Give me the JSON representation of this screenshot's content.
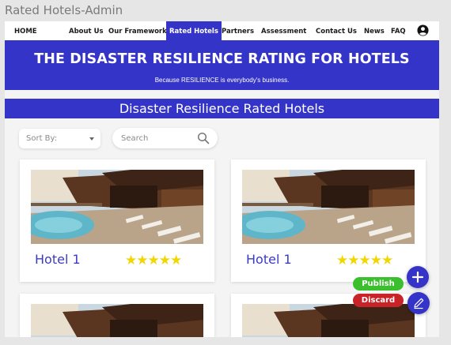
{
  "frame": {
    "title": "Rated Hotels-Admin"
  },
  "nav": {
    "home": "HOME",
    "items": [
      {
        "label": "About Us"
      },
      {
        "label": "Our Framework"
      },
      {
        "label": "Rated Hotels",
        "active": true
      },
      {
        "label": "Partners"
      },
      {
        "label": "Assessment"
      },
      {
        "label": "Contact Us"
      },
      {
        "label": "News"
      },
      {
        "label": "FAQ"
      }
    ],
    "user_icon": "account-circle-icon"
  },
  "hero": {
    "title": "THE DISASTER RESILIENCE RATING FOR HOTELS",
    "subtitle": "Because RESILIENCE is everybody's business."
  },
  "section": {
    "title": "Disaster Resilience Rated Hotels"
  },
  "filters": {
    "sort_label": "Sort By:",
    "search_placeholder": "Search"
  },
  "hotels": [
    {
      "name": "Hotel 1",
      "rating": 5
    },
    {
      "name": "Hotel 1",
      "rating": 5
    }
  ],
  "actions": {
    "publish": "Publish",
    "discard": "Discard",
    "add_icon": "plus-icon",
    "edit_icon": "pencil-icon"
  },
  "colors": {
    "brand": "#3434c9",
    "hotel_name": "#3b3bc4",
    "star": "#f2d600",
    "publish": "#3bbf2e",
    "discard": "#c9232a"
  }
}
